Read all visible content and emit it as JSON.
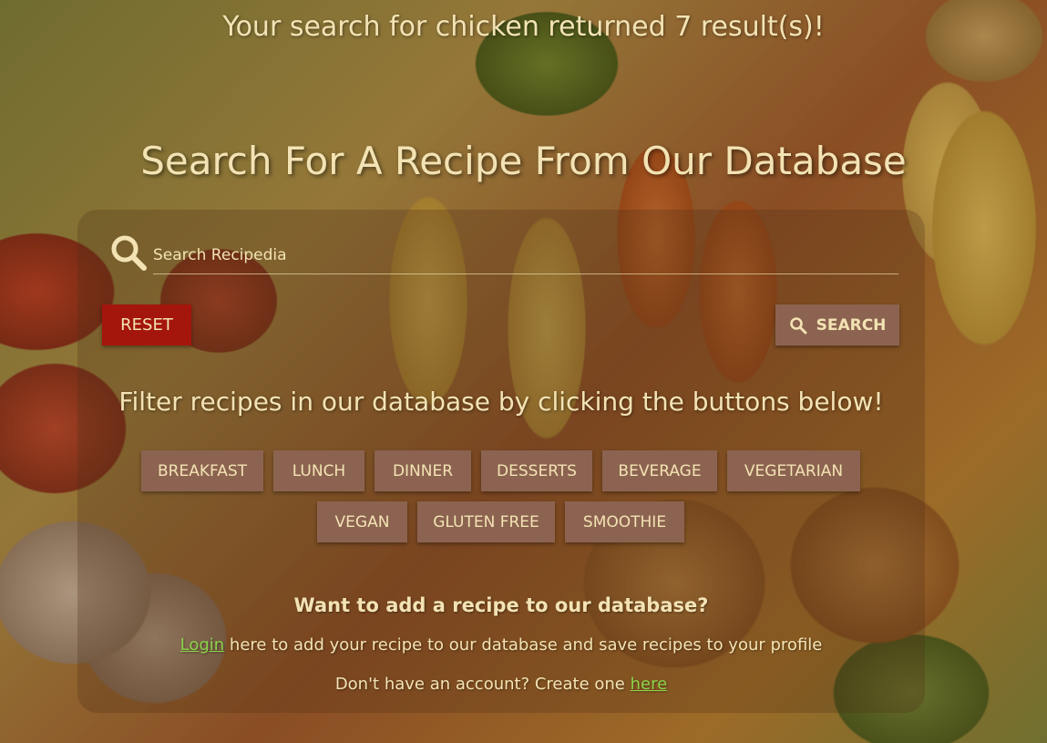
{
  "colors": {
    "text": "#f3e3b4",
    "reset_button": "#a4160c",
    "filter_button": "#8c6350",
    "link": "#8bd34a"
  },
  "result_message": "Your search for chicken returned 7 result(s)!",
  "page_title": "Search For A Recipe From Our Database",
  "search": {
    "placeholder": "Search Recipedia",
    "value": "",
    "icon": "search-icon",
    "reset_label": "RESET",
    "search_label": "SEARCH"
  },
  "filters": {
    "heading": "Filter recipes in our database by clicking the buttons below!",
    "buttons": [
      "BREAKFAST",
      "LUNCH",
      "DINNER",
      "DESSERTS",
      "BEVERAGE",
      "VEGETARIAN",
      "VEGAN",
      "GLUTEN FREE",
      "SMOOTHIE"
    ]
  },
  "add_recipe": {
    "heading": "Want to add a recipe to our database?",
    "login_link": "Login",
    "login_text": " here to add your recipe to our database and save recipes to your profile",
    "signup_text": "Don't have an account? Create one ",
    "signup_link": "here"
  }
}
